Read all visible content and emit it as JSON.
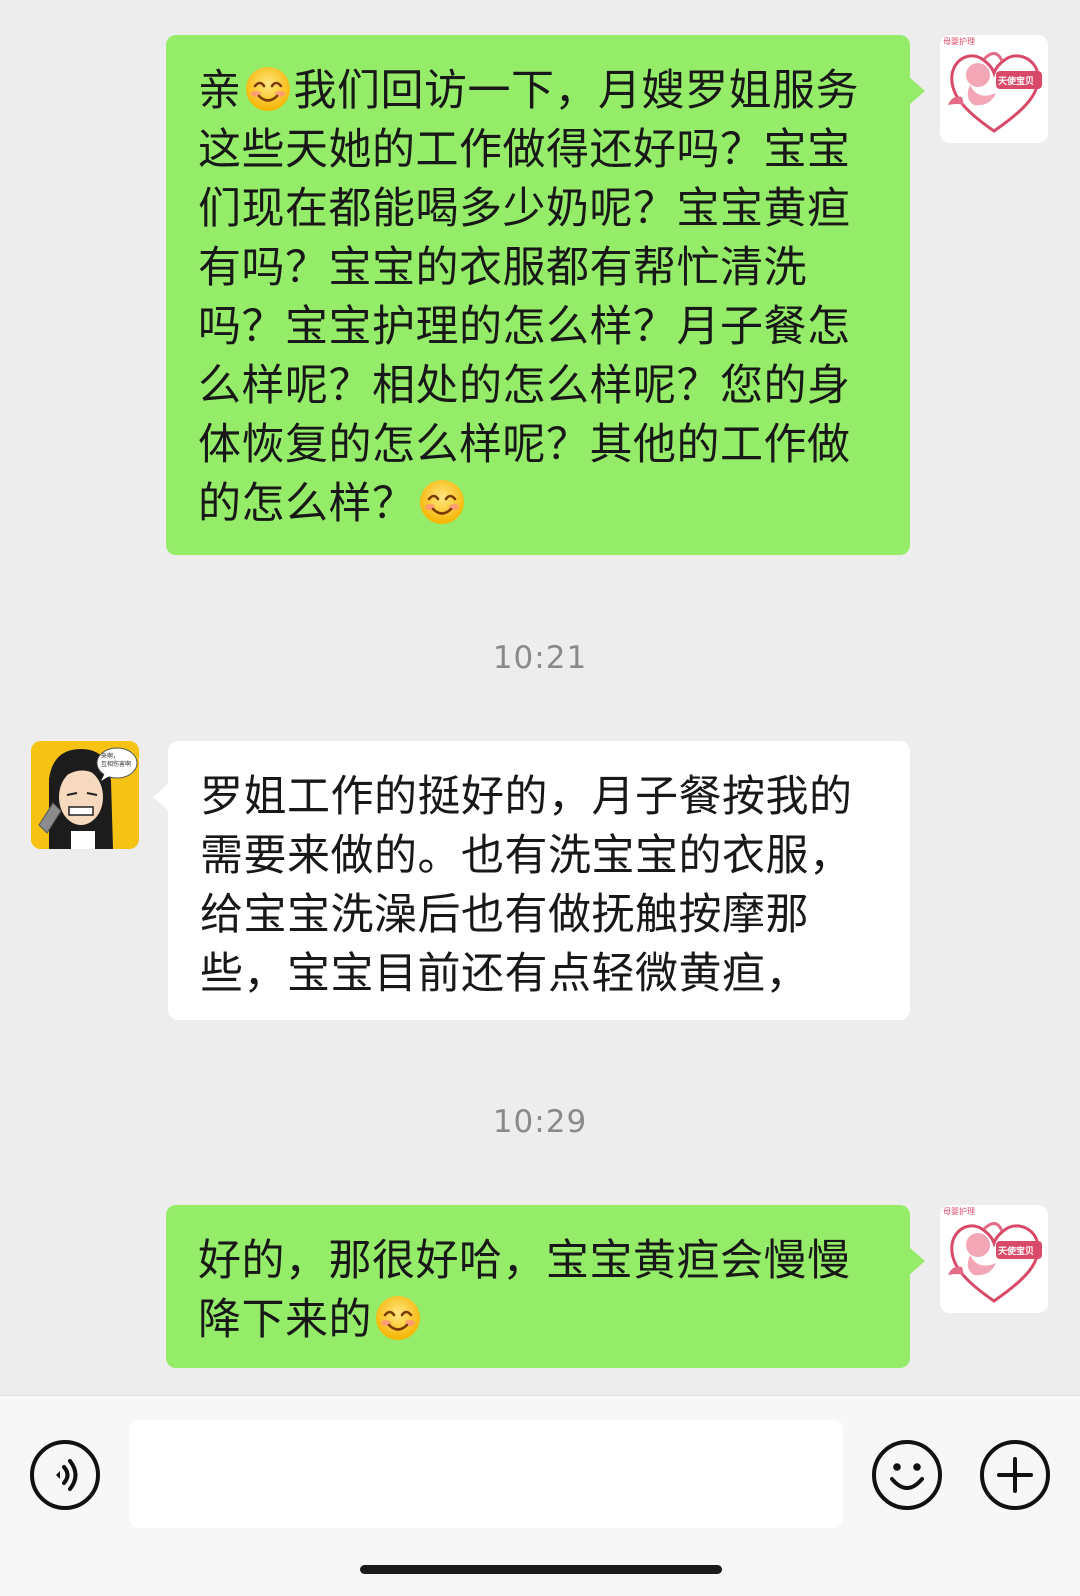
{
  "messages": [
    {
      "direction": "out",
      "sender": "shop",
      "avatar_text": {
        "top": "母婴护理",
        "badge": "天使宝贝"
      },
      "lines": [
        "亲😊我们回访一下，月嫂罗姐服务",
        "这些天她的工作做得还好吗？宝宝",
        "们现在都能喝多少奶呢？宝宝黄疸",
        "有吗？宝宝的衣服都有帮忙清洗",
        "吗？宝宝护理的怎么样？月子餐怎",
        "么样呢？相处的怎么样呢？您的身",
        "体恢复的怎么样呢？其他的工作做",
        "的怎么样？😊"
      ]
    },
    {
      "type": "time",
      "text": "10:21"
    },
    {
      "direction": "in",
      "sender": "customer",
      "avatar_text": {
        "bubble": "来啊，\n互相伤害啊"
      },
      "lines": [
        "罗姐工作的挺好的，月子餐按我的",
        "需要来做的。也有洗宝宝的衣服，",
        "给宝宝洗澡后也有做抚触按摩那",
        "些，宝宝目前还有点轻微黄疸，"
      ]
    },
    {
      "type": "time",
      "text": "10:29"
    },
    {
      "direction": "out",
      "sender": "shop",
      "avatar_text": {
        "top": "母婴护理",
        "badge": "天使宝贝"
      },
      "lines": [
        "好的，那很好哈，宝宝黄疸会慢慢",
        "降下来的😊"
      ]
    }
  ],
  "input_bar": {
    "voice_icon": "voice-icon",
    "emoji_icon": "emoji-face-icon",
    "plus_icon": "plus-icon",
    "input_value": ""
  },
  "colors": {
    "outgoing_bubble": "#95ec69",
    "incoming_bubble": "#ffffff",
    "background": "#ededed",
    "timestamp": "#8a8a8a"
  }
}
